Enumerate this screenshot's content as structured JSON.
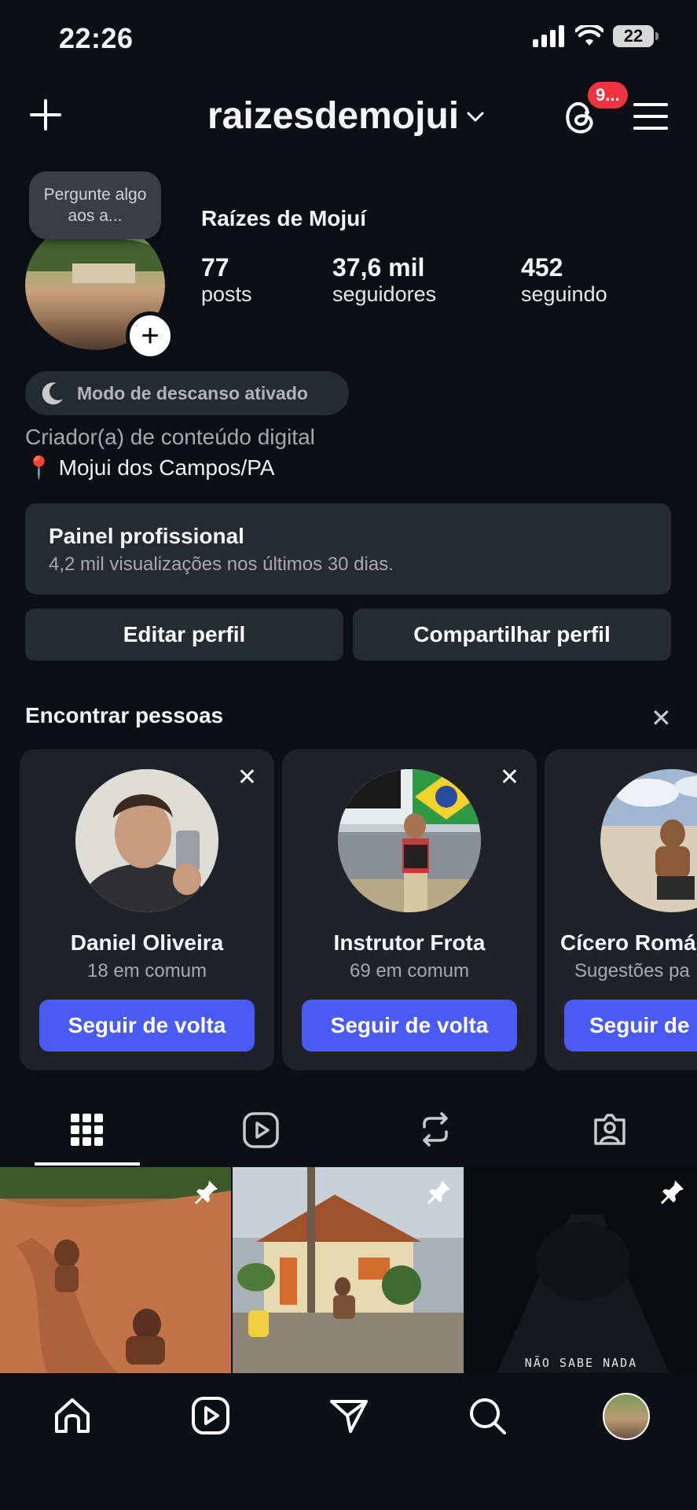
{
  "status_bar": {
    "time": "22:26",
    "battery": "22"
  },
  "header": {
    "username": "raizesdemojui",
    "notification_badge": "9..."
  },
  "profile": {
    "note_bubble": "Pergunte algo aos a...",
    "display_name": "Raízes de Mojuí",
    "stats": [
      {
        "value": "77",
        "label": "posts"
      },
      {
        "value": "37,6 mil",
        "label": "seguidores"
      },
      {
        "value": "452",
        "label": "seguindo"
      }
    ],
    "rest_mode": "Modo de descanso ativado",
    "category": "Criador(a) de conteúdo digital",
    "location": "Mojui dos Campos/PA",
    "location_emoji": "📍"
  },
  "pro_panel": {
    "title": "Painel profissional",
    "subtitle": "4,2 mil visualizações nos últimos 30 dias."
  },
  "actions": {
    "edit": "Editar perfil",
    "share": "Compartilhar perfil"
  },
  "find_people": {
    "title": "Encontrar pessoas",
    "cards": [
      {
        "name": "Daniel Oliveira",
        "mutual": "18 em comum",
        "button": "Seguir de volta"
      },
      {
        "name": "Instrutor Frota",
        "mutual": "69 em comum",
        "button": "Seguir de volta"
      },
      {
        "name": "Cícero Romá",
        "mutual": "Sugestões pa",
        "button": "Seguir de"
      }
    ]
  },
  "grid": {
    "post3_caption": "NÃO SABE NADA"
  },
  "colors": {
    "background": "#0c0f14",
    "panel": "#262a31",
    "accent_blue": "#4a5bf4",
    "badge_red": "#ef3340"
  }
}
